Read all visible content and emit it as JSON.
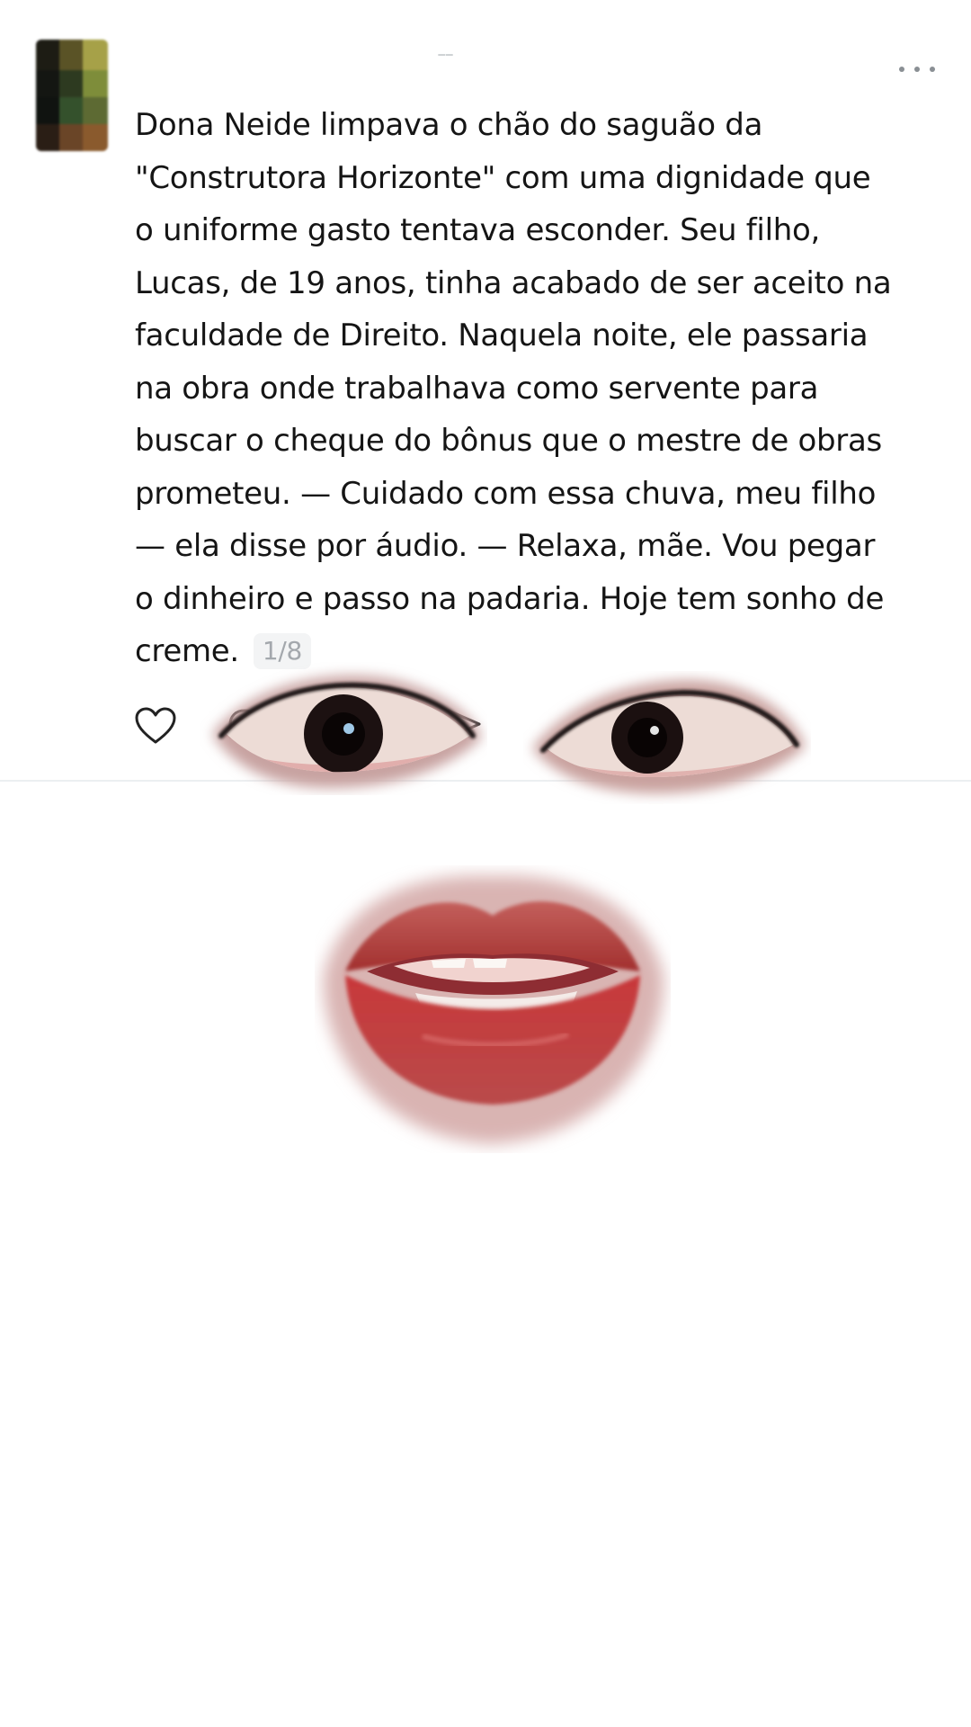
{
  "post": {
    "text_lines": [
      "Dona Neide limpava o chão do saguão da",
      "\"Construtora Horizonte\" com uma dignidade que",
      "o uniforme gasto tentava esconder. Seu filho,",
      "Lucas, de 19 anos, tinha acabado de ser aceito na",
      "faculdade de Direito. Naquela noite, ele passaria",
      "na obra onde trabalhava como servente para",
      "buscar o cheque do bônus que o mestre de obras",
      "prometeu. — Cuidado com essa chuva, meu filho",
      "— ela disse por áudio. — Relaxa, mãe. Vou pegar",
      "o dinheiro e passo na padaria. Hoje tem sonho de",
      "creme."
    ],
    "page_counter": "1/8"
  },
  "icons": {
    "more": "more-dots-icon",
    "like": "heart-icon",
    "comment": "comment-bubble-icon",
    "share": "share-arrow-icon"
  },
  "colors": {
    "text": "#151515",
    "muted": "#a4a8ad",
    "divider": "#eceff1",
    "lip": "#b8393a"
  }
}
